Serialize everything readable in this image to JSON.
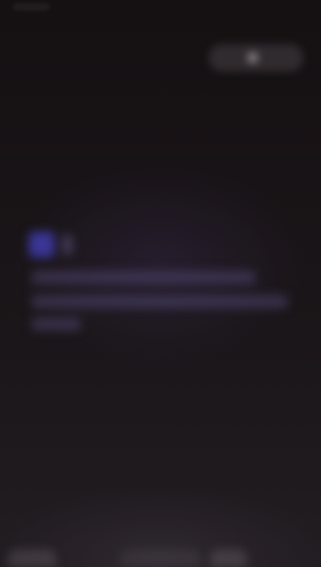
{
  "status_bar": {
    "indicator_icon": "status-indicator-icon"
  },
  "top_action": {
    "label": "",
    "icon": "avatar-icon"
  },
  "card": {
    "icon": "content-icon",
    "headline": "",
    "lines": [
      "",
      "",
      ""
    ]
  },
  "bottom_nav": {
    "items": [
      {
        "label": "",
        "icon": "nav-icon-left"
      },
      {
        "label": "",
        "icon": "nav-icon-center"
      },
      {
        "label": "",
        "icon": "nav-icon-right"
      }
    ]
  },
  "colors": {
    "background": "#171214",
    "accent": "#3b3696",
    "text_primary": "#cfc8e6",
    "text_secondary": "#b9aecd"
  }
}
